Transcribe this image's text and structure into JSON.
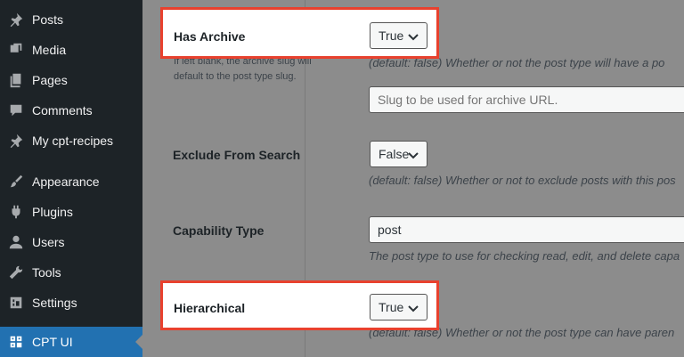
{
  "sidebar": {
    "items": [
      {
        "label": "Posts",
        "icon": "pin-icon"
      },
      {
        "label": "Media",
        "icon": "media-icon"
      },
      {
        "label": "Pages",
        "icon": "pages-icon"
      },
      {
        "label": "Comments",
        "icon": "comments-icon"
      },
      {
        "label": "My cpt-recipes",
        "icon": "pin-icon"
      },
      {
        "label": "Appearance",
        "icon": "brush-icon"
      },
      {
        "label": "Plugins",
        "icon": "plugin-icon"
      },
      {
        "label": "Users",
        "icon": "user-icon"
      },
      {
        "label": "Tools",
        "icon": "wrench-icon"
      },
      {
        "label": "Settings",
        "icon": "settings-icon"
      },
      {
        "label": "CPT UI",
        "icon": "cpt-ui-icon"
      }
    ]
  },
  "fields": {
    "has_archive": {
      "label": "Has Archive",
      "value": "True",
      "help": "If left blank, the archive slug will default to the post type slug.",
      "desc": "(default: false) Whether or not the post type will have a po",
      "slug_placeholder": "Slug to be used for archive URL."
    },
    "exclude_from_search": {
      "label": "Exclude From Search",
      "value": "False",
      "desc": "(default: false) Whether or not to exclude posts with this pos"
    },
    "capability_type": {
      "label": "Capability Type",
      "value": "post",
      "desc": "The post type to use for checking read, edit, and delete capa"
    },
    "hierarchical": {
      "label": "Hierarchical",
      "value": "True",
      "desc": "(default: false) Whether or not the post type can have paren"
    }
  },
  "colors": {
    "sidebar_bg": "#1d2327",
    "active": "#2271b1",
    "highlight_border": "#e8412e",
    "overlay_bg": "#8c8c8c"
  }
}
